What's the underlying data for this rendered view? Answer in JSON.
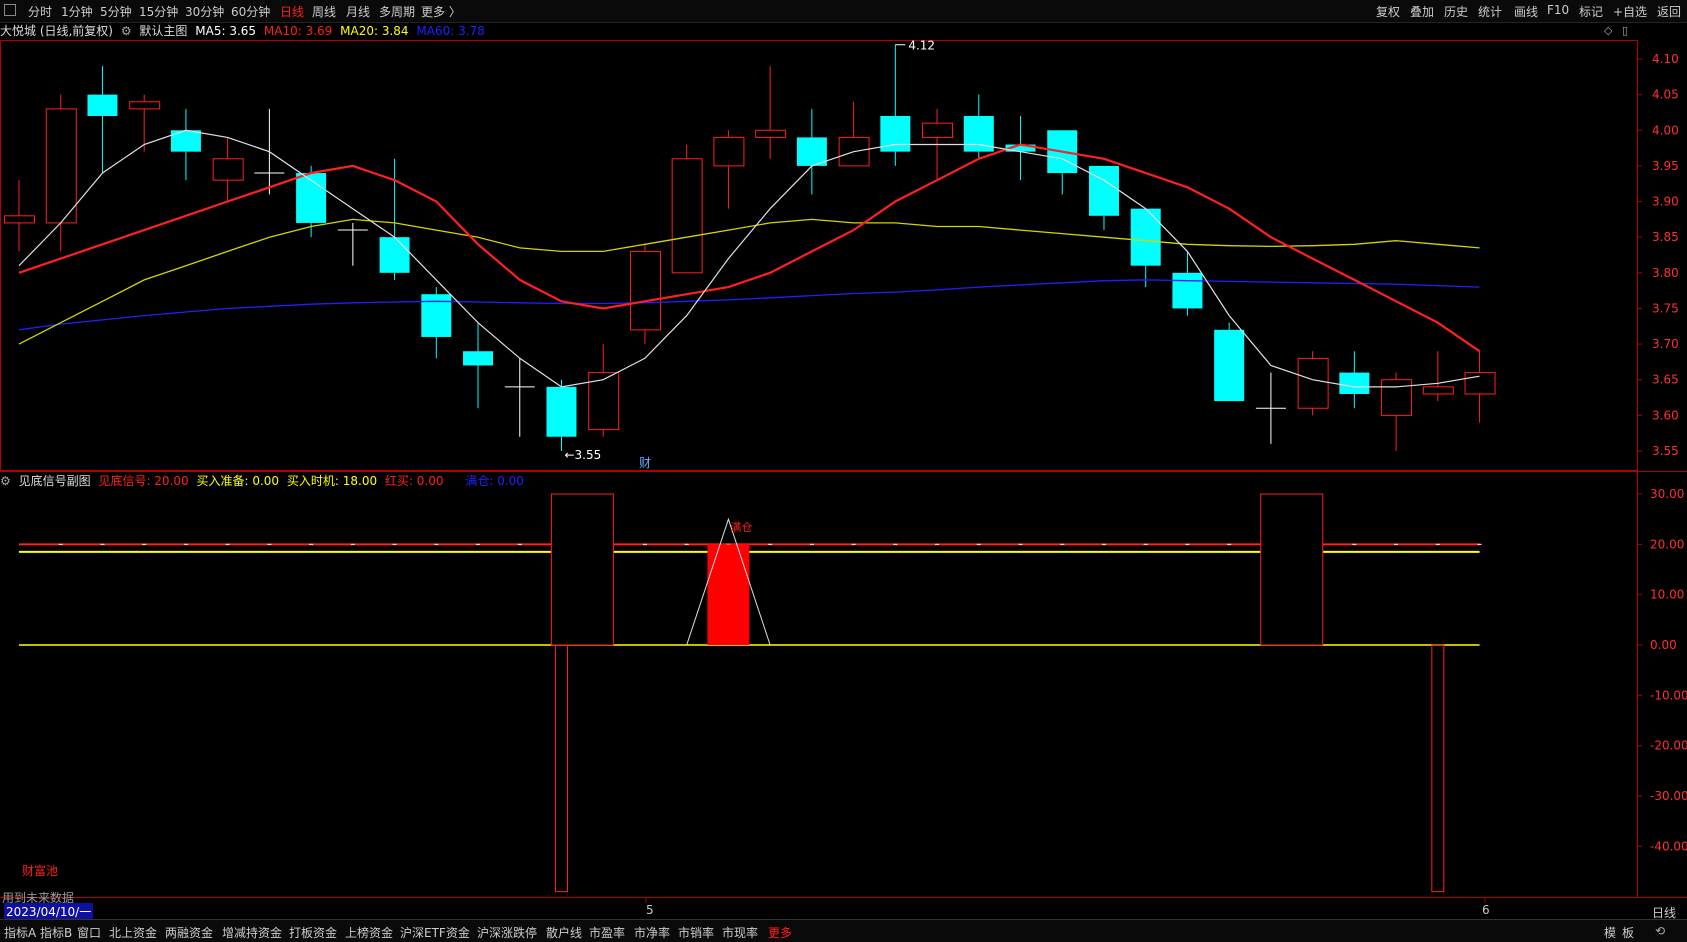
{
  "header": {
    "period_tabs": [
      "分时",
      "1分钟",
      "5分钟",
      "15分钟",
      "30分钟",
      "60分钟",
      "日线",
      "周线",
      "月线",
      "多周期",
      "更多 〉"
    ],
    "active_period": "日线",
    "right_buttons": [
      "复权",
      "叠加",
      "历史",
      "统计",
      "画线",
      "F10",
      "标记",
      "+自选",
      "返回"
    ]
  },
  "main": {
    "stock_title": "大悦城 (日线,前复权)",
    "chart_name": "默认主图",
    "ma5": {
      "label": "MA5: 3.65",
      "color": "#ffffff"
    },
    "ma10": {
      "label": "MA10: 3.69",
      "color": "#ff2020"
    },
    "ma20": {
      "label": "MA20: 3.84",
      "color": "#ffff00"
    },
    "ma60": {
      "label": "MA60: 3.78",
      "color": "#2020ff"
    },
    "high_label": "4.12",
    "low_label": "3.55",
    "cai_marker": "财"
  },
  "sub": {
    "chart_name": "见底信号副图",
    "legend": [
      {
        "label": "见底信号: 20.00",
        "color": "#ff2020"
      },
      {
        "label": "买入准备: 0.00",
        "color": "#ffff00"
      },
      {
        "label": "买入时机: 18.00",
        "color": "#ffff00"
      },
      {
        "label": "红买: 0.00",
        "color": "#ff2020"
      },
      {
        "label": "满仓: 0.00",
        "color": "#2020ff"
      }
    ],
    "mancang_label": "满仓",
    "caifuchi": "财富池",
    "future_data": "用到未来数据"
  },
  "xaxis": {
    "date_label": "2023/04/10/一",
    "month5": "5",
    "month6": "6"
  },
  "period_label": "日线",
  "bottom": {
    "tabs": [
      "指标A",
      "指标B",
      "窗口",
      "北上资金",
      "两融资金",
      "增减持资金",
      "打板资金",
      "上榜资金",
      "沪深ETF资金",
      "沪深涨跌停",
      "散户线",
      "市盈率",
      "市净率",
      "市销率",
      "市现率",
      "更多"
    ],
    "right": [
      "模",
      "板"
    ]
  },
  "chart_data": [
    {
      "type": "candlestick",
      "title": "大悦城 (日线,前复权)",
      "ylim": [
        3.52,
        4.15
      ],
      "yticks": [
        4.1,
        4.05,
        4.0,
        3.95,
        3.9,
        3.85,
        3.8,
        3.75,
        3.7,
        3.65,
        3.6,
        3.55
      ],
      "candles": [
        {
          "o": 3.87,
          "h": 3.93,
          "l": 3.83,
          "c": 3.88
        },
        {
          "o": 3.87,
          "h": 4.05,
          "l": 3.83,
          "c": 4.03
        },
        {
          "o": 4.05,
          "h": 4.09,
          "l": 3.94,
          "c": 4.02
        },
        {
          "o": 4.03,
          "h": 4.05,
          "l": 3.97,
          "c": 4.04
        },
        {
          "o": 4.0,
          "h": 4.03,
          "l": 3.93,
          "c": 3.97
        },
        {
          "o": 3.93,
          "h": 3.99,
          "l": 3.9,
          "c": 3.96
        },
        {
          "o": 3.94,
          "h": 4.03,
          "l": 3.91,
          "c": 3.94
        },
        {
          "o": 3.94,
          "h": 3.95,
          "l": 3.85,
          "c": 3.87
        },
        {
          "o": 3.86,
          "h": 3.87,
          "l": 3.81,
          "c": 3.86
        },
        {
          "o": 3.85,
          "h": 3.96,
          "l": 3.79,
          "c": 3.8
        },
        {
          "o": 3.77,
          "h": 3.78,
          "l": 3.68,
          "c": 3.71
        },
        {
          "o": 3.69,
          "h": 3.73,
          "l": 3.61,
          "c": 3.67
        },
        {
          "o": 3.64,
          "h": 3.68,
          "l": 3.57,
          "c": 3.64
        },
        {
          "o": 3.64,
          "h": 3.65,
          "l": 3.55,
          "c": 3.57
        },
        {
          "o": 3.58,
          "h": 3.7,
          "l": 3.57,
          "c": 3.66
        },
        {
          "o": 3.72,
          "h": 3.84,
          "l": 3.7,
          "c": 3.83
        },
        {
          "o": 3.8,
          "h": 3.98,
          "l": 3.8,
          "c": 3.96
        },
        {
          "o": 3.95,
          "h": 4.0,
          "l": 3.89,
          "c": 3.99
        },
        {
          "o": 3.99,
          "h": 4.09,
          "l": 3.96,
          "c": 4.0
        },
        {
          "o": 3.99,
          "h": 4.03,
          "l": 3.91,
          "c": 3.95
        },
        {
          "o": 3.95,
          "h": 4.04,
          "l": 3.95,
          "c": 3.99
        },
        {
          "o": 4.02,
          "h": 4.12,
          "l": 3.95,
          "c": 3.97
        },
        {
          "o": 3.99,
          "h": 4.03,
          "l": 3.93,
          "c": 4.01
        },
        {
          "o": 4.02,
          "h": 4.05,
          "l": 3.96,
          "c": 3.97
        },
        {
          "o": 3.98,
          "h": 4.02,
          "l": 3.93,
          "c": 3.97
        },
        {
          "o": 4.0,
          "h": 4.0,
          "l": 3.91,
          "c": 3.94
        },
        {
          "o": 3.95,
          "h": 3.95,
          "l": 3.86,
          "c": 3.88
        },
        {
          "o": 3.89,
          "h": 3.89,
          "l": 3.78,
          "c": 3.81
        },
        {
          "o": 3.8,
          "h": 3.83,
          "l": 3.74,
          "c": 3.75
        },
        {
          "o": 3.72,
          "h": 3.73,
          "l": 3.62,
          "c": 3.62
        },
        {
          "o": 3.61,
          "h": 3.66,
          "l": 3.56,
          "c": 3.61
        },
        {
          "o": 3.61,
          "h": 3.69,
          "l": 3.6,
          "c": 3.68
        },
        {
          "o": 3.66,
          "h": 3.69,
          "l": 3.61,
          "c": 3.63
        },
        {
          "o": 3.6,
          "h": 3.66,
          "l": 3.55,
          "c": 3.65
        },
        {
          "o": 3.63,
          "h": 3.69,
          "l": 3.62,
          "c": 3.64
        },
        {
          "o": 3.63,
          "h": 3.69,
          "l": 3.59,
          "c": 3.66
        }
      ],
      "ma5": [
        3.81,
        3.87,
        3.94,
        3.98,
        4.0,
        3.99,
        3.97,
        3.93,
        3.89,
        3.85,
        3.79,
        3.73,
        3.68,
        3.64,
        3.65,
        3.68,
        3.74,
        3.82,
        3.89,
        3.95,
        3.97,
        3.98,
        3.98,
        3.98,
        3.97,
        3.96,
        3.93,
        3.89,
        3.83,
        3.74,
        3.67,
        3.65,
        3.64,
        3.64,
        3.645,
        3.655
      ],
      "ma10": [
        3.8,
        3.82,
        3.84,
        3.86,
        3.88,
        3.9,
        3.92,
        3.94,
        3.95,
        3.93,
        3.9,
        3.84,
        3.79,
        3.76,
        3.75,
        3.76,
        3.77,
        3.78,
        3.8,
        3.83,
        3.86,
        3.9,
        3.93,
        3.96,
        3.98,
        3.97,
        3.96,
        3.94,
        3.92,
        3.89,
        3.85,
        3.82,
        3.79,
        3.76,
        3.73,
        3.69
      ],
      "ma20": [
        3.7,
        3.73,
        3.76,
        3.79,
        3.81,
        3.83,
        3.85,
        3.865,
        3.875,
        3.87,
        3.86,
        3.85,
        3.835,
        3.83,
        3.83,
        3.84,
        3.85,
        3.86,
        3.87,
        3.875,
        3.87,
        3.87,
        3.865,
        3.865,
        3.86,
        3.855,
        3.85,
        3.845,
        3.84,
        3.838,
        3.837,
        3.838,
        3.84,
        3.845,
        3.84,
        3.835
      ],
      "ma60": [
        3.72,
        3.728,
        3.734,
        3.74,
        3.745,
        3.75,
        3.753,
        3.756,
        3.758,
        3.759,
        3.76,
        3.759,
        3.758,
        3.757,
        3.757,
        3.758,
        3.76,
        3.762,
        3.765,
        3.768,
        3.771,
        3.773,
        3.776,
        3.78,
        3.783,
        3.786,
        3.789,
        3.79,
        3.789,
        3.788,
        3.787,
        3.786,
        3.785,
        3.784,
        3.782,
        3.78
      ]
    },
    {
      "type": "bar",
      "title": "见底信号副图",
      "ylim": [
        -50,
        32
      ],
      "yticks": [
        30,
        20,
        10,
        0,
        -10,
        -20,
        -30,
        -40
      ],
      "baseline_line": 0,
      "signal_line_red": 20,
      "signal_line_yellow": 18.5,
      "black_bars": [
        {
          "i": 13.5,
          "value": 30
        },
        {
          "i": 30.5,
          "value": 30
        }
      ],
      "neg_bars": [
        {
          "i": 13,
          "value": -49
        },
        {
          "i": 34,
          "value": -49
        }
      ],
      "red_bar": {
        "i": 17,
        "value": 20
      },
      "triangle": {
        "from": 16,
        "peak": 17,
        "to": 18,
        "value": 25
      }
    }
  ]
}
